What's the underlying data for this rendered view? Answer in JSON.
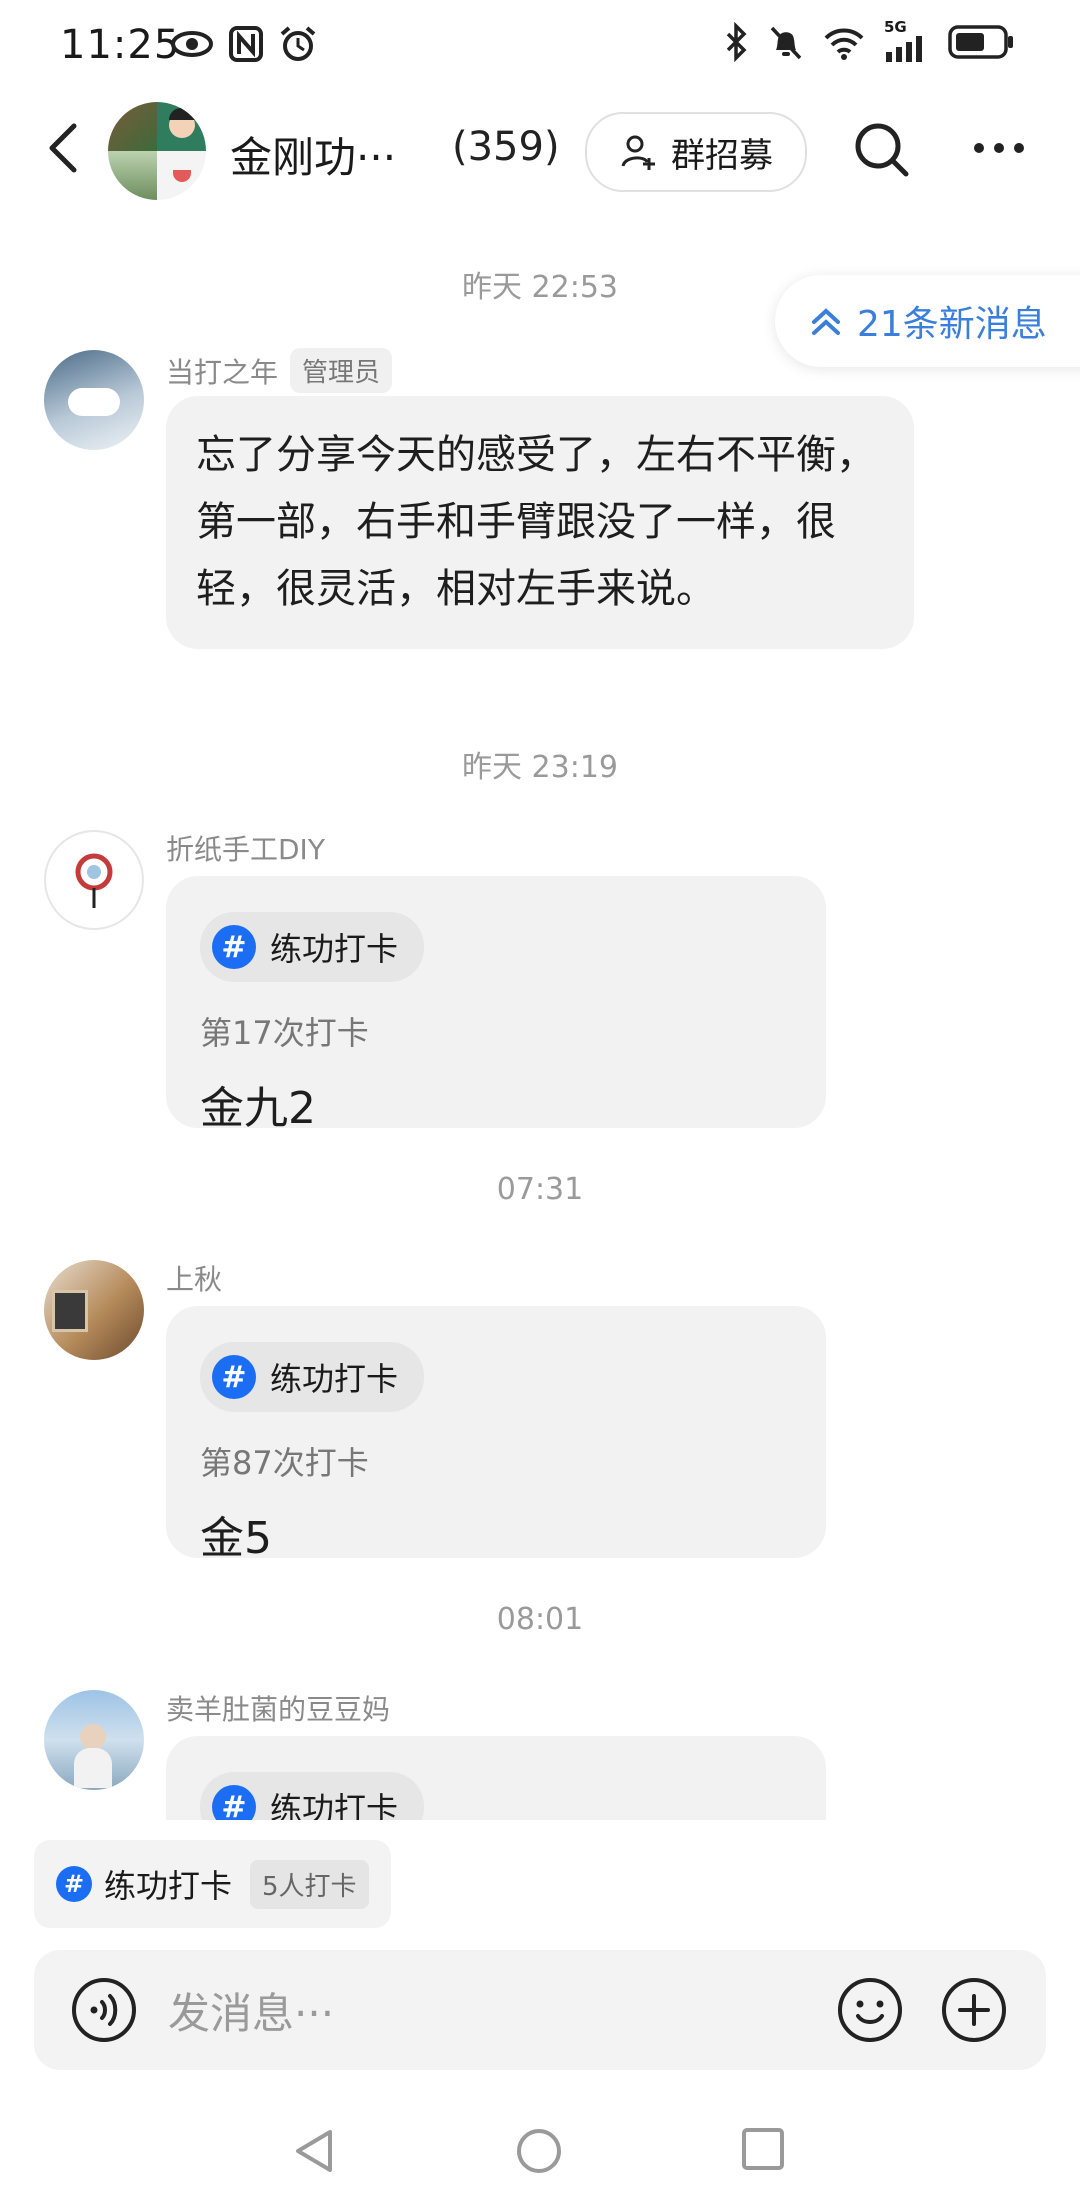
{
  "status_bar": {
    "time": "11:25",
    "network": "5G"
  },
  "header": {
    "group_name": "金刚功···",
    "member_count": "(359)",
    "recruit_label": "群招募"
  },
  "chat": {
    "new_messages": "21条新消息",
    "messages": [
      {
        "timestamp": "昨天 22:53",
        "sender": "当打之年",
        "badge": "管理员",
        "text": "忘了分享今天的感受了，左右不平衡，第一部，右手和手臂跟没了一样，很轻，很灵活，相对左手来说。"
      },
      {
        "timestamp": "昨天 23:19",
        "sender": "折纸手工DIY",
        "tag": "练功打卡",
        "checkin_count": "第17次打卡",
        "checkin_content": "金九2"
      },
      {
        "timestamp": "07:31",
        "sender": "上秋",
        "tag": "练功打卡",
        "checkin_count": "第87次打卡",
        "checkin_content": "金5"
      },
      {
        "timestamp": "08:01",
        "sender": "卖羊肚菌的豆豆妈",
        "tag": "练功打卡"
      }
    ]
  },
  "bottom": {
    "checkin_tag": "练功打卡",
    "people_count": "5人打卡",
    "input_placeholder": "发消息···"
  }
}
